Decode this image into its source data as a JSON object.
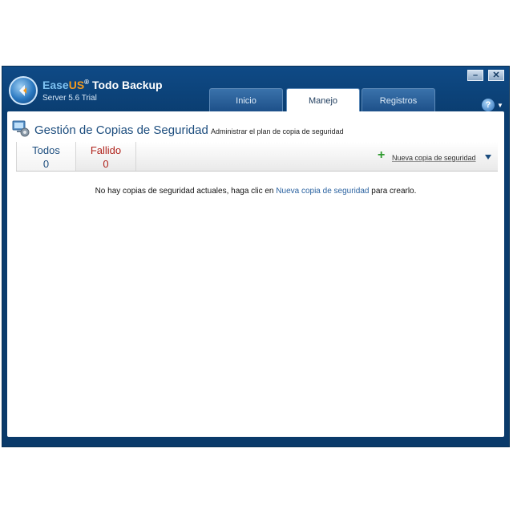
{
  "app": {
    "brand_ease": "Ease",
    "brand_us": "US",
    "brand_reg": "®",
    "brand_rest": " Todo Backup",
    "edition": "Server 5.6 Trial"
  },
  "window_controls": {
    "minimize": "–",
    "close": "✕",
    "help": "?"
  },
  "tabs": [
    {
      "label": "Inicio",
      "active": false
    },
    {
      "label": "Manejo",
      "active": true
    },
    {
      "label": "Registros",
      "active": false
    }
  ],
  "page": {
    "title": "Gestión de Copias de Seguridad",
    "subtitle": "Administrar el plan de copia de seguridad"
  },
  "filters": [
    {
      "label": "Todos",
      "count": "0",
      "color": "#1c4d7e"
    },
    {
      "label": "Fallido",
      "count": "0",
      "color": "#b0241d"
    }
  ],
  "toolbar": {
    "new_backup_label": "Nueva copia de seguridad",
    "icon": "plus-icon"
  },
  "message": {
    "before": "No hay copias de seguridad actuales, haga clic en ",
    "link": "Nueva copia de seguridad",
    "after": " para crearlo."
  },
  "colors": {
    "titlebar": "#0f4a86",
    "accent": "#1c4d7e",
    "link": "#2a62a0",
    "brand_orange": "#f39a1e"
  }
}
